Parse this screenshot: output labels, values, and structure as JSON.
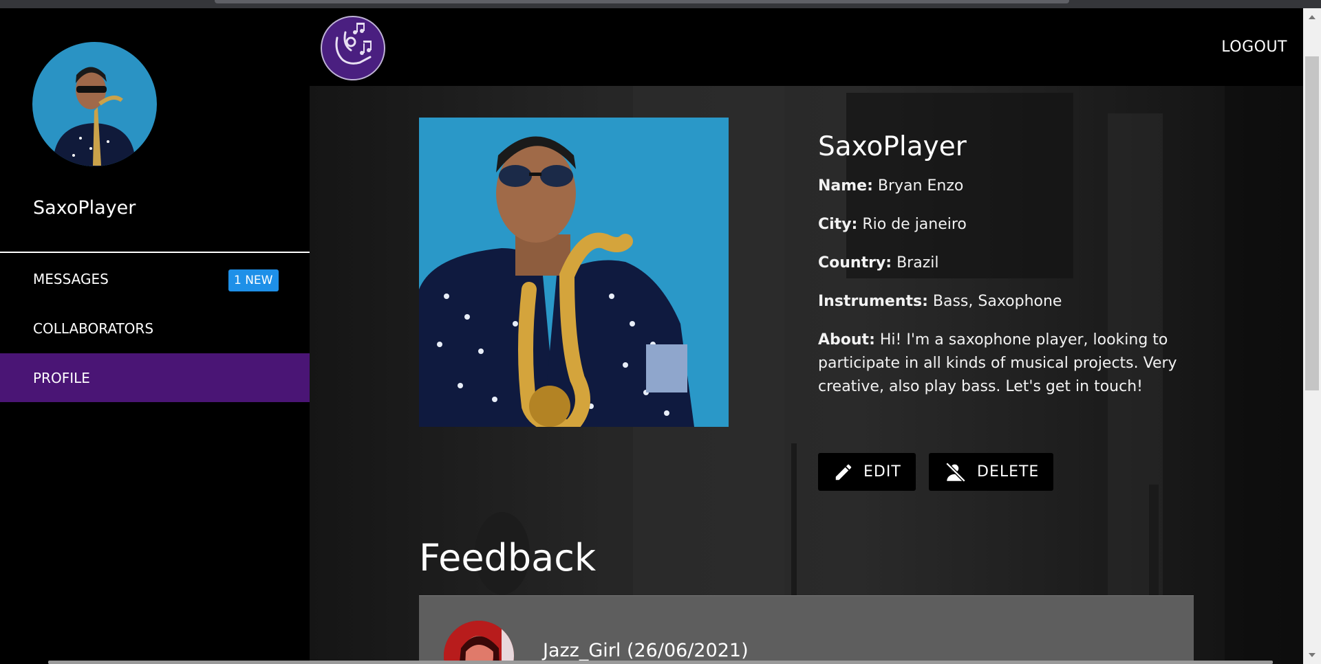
{
  "sidebar": {
    "username": "SaxoPlayer",
    "nav": [
      {
        "label": "MESSAGES",
        "badge": "1 NEW"
      },
      {
        "label": "COLLABORATORS"
      },
      {
        "label": "PROFILE"
      }
    ]
  },
  "header": {
    "logout_label": "LOGOUT"
  },
  "profile": {
    "username": "SaxoPlayer",
    "name_label": "Name:",
    "name": "Bryan Enzo",
    "city_label": "City:",
    "city": "Rio de janeiro",
    "country_label": "Country:",
    "country": "Brazil",
    "instruments_label": "Instruments:",
    "instruments": "Bass, Saxophone",
    "about_label": "About:",
    "about": "Hi! I'm a saxophone player, looking to participate in all kinds of musical projects. Very creative, also play bass. Let's get in touch!",
    "edit_label": "EDIT",
    "delete_label": "DELETE"
  },
  "feedback": {
    "title": "Feedback",
    "items": [
      {
        "author": "Jazz_Girl (26/06/2021)"
      }
    ]
  },
  "colors": {
    "accent": "#4a1575",
    "badge": "#1e90e8",
    "logo_bg": "#4a1f80"
  }
}
